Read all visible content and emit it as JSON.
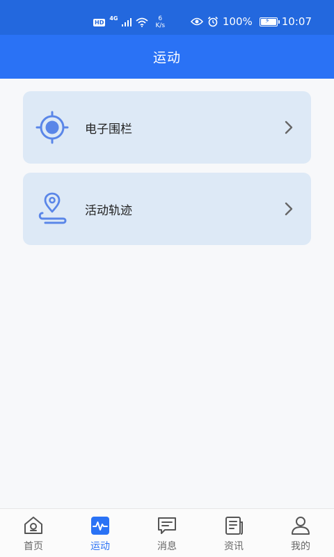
{
  "status_bar": {
    "hd": "HD",
    "network": "4G",
    "speed_value": "6",
    "speed_unit": "K/s",
    "battery": "100%",
    "time": "10:07"
  },
  "header": {
    "title": "运动"
  },
  "menu": [
    {
      "label": "电子围栏",
      "icon": "target-icon"
    },
    {
      "label": "活动轨迹",
      "icon": "location-path-icon"
    }
  ],
  "tabs": [
    {
      "label": "首页",
      "icon": "home-icon",
      "active": false
    },
    {
      "label": "运动",
      "icon": "activity-icon",
      "active": true
    },
    {
      "label": "消息",
      "icon": "message-icon",
      "active": false
    },
    {
      "label": "资讯",
      "icon": "news-icon",
      "active": false
    },
    {
      "label": "我的",
      "icon": "profile-icon",
      "active": false
    }
  ],
  "colors": {
    "status_bar": "#2368de",
    "header": "#2a72f5",
    "card_bg": "#dde9f6",
    "icon_blue": "#5a86e8",
    "active_tab": "#2a72f5"
  }
}
